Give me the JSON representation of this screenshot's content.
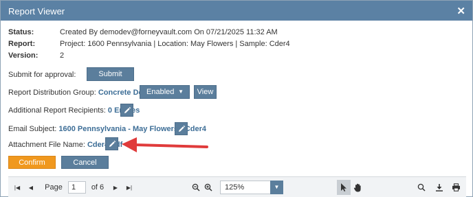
{
  "window": {
    "title": "Report Viewer",
    "close_icon": "close-icon"
  },
  "info": {
    "status_label": "Status:",
    "status_value": "Created By demodev@forneyvault.com On 07/21/2025 11:32 AM",
    "report_label": "Report:",
    "report_value": "Project: 1600 Pennsylvania | Location: May Flowers | Sample: Cder4",
    "version_label": "Version:",
    "version_value": "2"
  },
  "approval": {
    "label": "Submit for approval:",
    "submit_label": "Submit"
  },
  "distribution": {
    "label": "Report Distribution Group:",
    "group": "Concrete Doctors",
    "status_selected": "Enabled",
    "view_label": "View"
  },
  "recipients": {
    "label": "Additional Report Recipients:",
    "value": "0 Entries"
  },
  "email": {
    "label": "Email Subject:",
    "value": "1600 Pennsylvania - May Flowers - Cder4"
  },
  "attachment": {
    "label": "Attachment File Name:",
    "value": "Cder4.pdf"
  },
  "actions": {
    "confirm_label": "Confirm",
    "cancel_label": "Cancel"
  },
  "toolbar": {
    "page_label": "Page",
    "page_value": "1",
    "page_total": "of 6",
    "zoom_value": "125%"
  },
  "colors": {
    "title_bar": "#5b81a4",
    "button": "#5b7e9c",
    "confirm": "#f0981e",
    "link": "#3c6d96",
    "annotation_arrow": "#e03b3b"
  }
}
